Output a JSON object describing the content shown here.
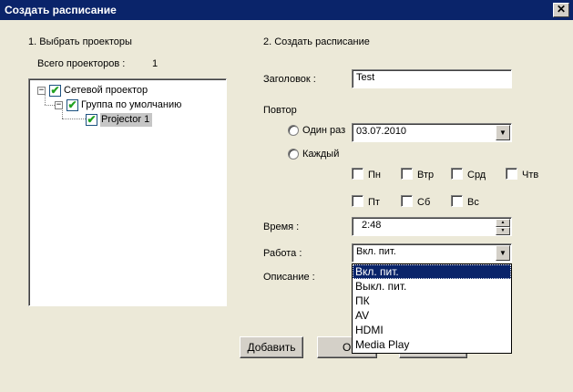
{
  "window": {
    "title": "Создать расписание",
    "close_glyph": "✕"
  },
  "left": {
    "section_title": "1. Выбрать проекторы",
    "total_label": "Всего проекторов :",
    "total_value": "1",
    "tree": [
      {
        "label": "Сетевой проектор",
        "expander": "−",
        "checked": true
      },
      {
        "label": "Группа по умолчанию",
        "expander": "−",
        "checked": true
      },
      {
        "label": "Projector 1",
        "checked": true,
        "selected": true
      }
    ]
  },
  "right": {
    "section_title": "2. Создать расписание",
    "title_label": "Заголовок :",
    "title_value": "Test",
    "repeat_label": "Повтор",
    "once_label": "Один раз",
    "once_date": "03.07.2010",
    "every_label": "Каждый",
    "days": [
      "Пн",
      "Втр",
      "Срд",
      "Чтв",
      "Пт",
      "Сб",
      "Вс"
    ],
    "time_label": "Время :",
    "time_value": "2:48",
    "work_label": "Работа :",
    "work_value": "Вкл. пит.",
    "work_options": [
      "Вкл. пит.",
      "Выкл. пит.",
      "ПК",
      "AV",
      "HDMI",
      "Media Play"
    ],
    "desc_label": "Описание :"
  },
  "buttons": {
    "add": "Добавить",
    "ok_partial": "О"
  },
  "icons": {
    "checkmark": "✔",
    "dropdown_arrow": "▼",
    "spin_up": "▲",
    "spin_down": "▼"
  },
  "colors": {
    "titlebar": "#0a246a",
    "face": "#ece9d8",
    "check_green": "#21a121",
    "selection": "#0a246a"
  }
}
